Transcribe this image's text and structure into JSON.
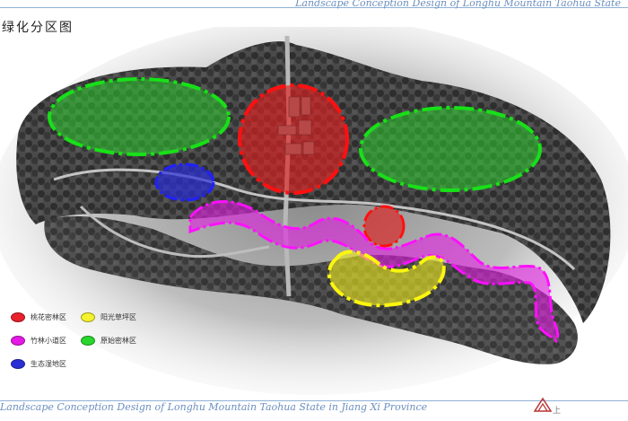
{
  "header": {
    "title": "Landscape Conception Design of  Longhu Mountain Taohua State"
  },
  "map_title": "绿化分区图",
  "legend": {
    "items": [
      {
        "label": "桃花密林区",
        "color": "#e8212b"
      },
      {
        "label": "阳光草坪区",
        "color": "#f4f22e"
      },
      {
        "label": "竹林小道区",
        "color": "#e619e6"
      },
      {
        "label": "原始密林区",
        "color": "#29d62d"
      },
      {
        "label": "生态湿地区",
        "color": "#2a2ed6"
      }
    ]
  },
  "footer": {
    "title": "Landscape Conception Design of  Longhu Mountain Taohua State in Jiang Xi Province",
    "logo_text": "上"
  },
  "colors": {
    "background": "#ffffff",
    "frame_line": "#8fb1d6",
    "dark_trees": "#3a3a3a",
    "ground": "#9a9a9a"
  }
}
